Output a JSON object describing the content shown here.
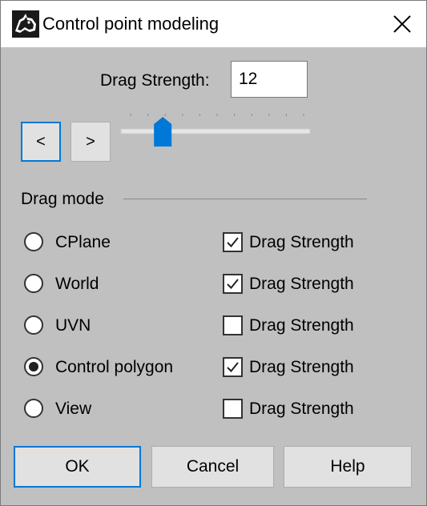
{
  "window": {
    "title": "Control point modeling",
    "app_icon": "rhino-icon",
    "close_icon": "close-icon"
  },
  "drag_strength": {
    "label": "Drag Strength:",
    "value": "12",
    "prev_label": "<",
    "next_label": ">",
    "slider_level": 0.12
  },
  "drag_mode": {
    "group_label": "Drag mode",
    "selected": "Control polygon",
    "options": [
      {
        "label": "CPlane",
        "selected": false,
        "check_label": "Drag Strength",
        "checked": true
      },
      {
        "label": "World",
        "selected": false,
        "check_label": "Drag Strength",
        "checked": true
      },
      {
        "label": "UVN",
        "selected": false,
        "check_label": "Drag Strength",
        "checked": false
      },
      {
        "label": "Control polygon",
        "selected": true,
        "check_label": "Drag Strength",
        "checked": true
      },
      {
        "label": "View",
        "selected": false,
        "check_label": "Drag Strength",
        "checked": false
      }
    ]
  },
  "buttons": {
    "ok": "OK",
    "cancel": "Cancel",
    "help": "Help"
  },
  "colors": {
    "accent": "#0078d7",
    "dialog_background": "#c0c0c0"
  }
}
